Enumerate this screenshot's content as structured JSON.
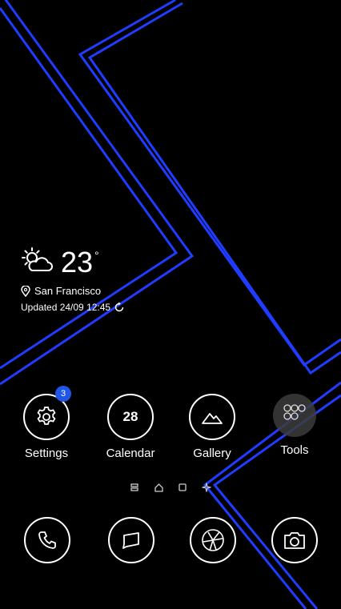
{
  "weather": {
    "temperature": "23",
    "unit": "°",
    "location": "San Francisco",
    "updated": "Updated 24/09 12:45",
    "icon": "partly-cloudy-icon"
  },
  "apps": [
    {
      "label": "Settings",
      "badge": "3",
      "icon": "gear-icon"
    },
    {
      "label": "Calendar",
      "day": "28",
      "icon": "calendar-icon"
    },
    {
      "label": "Gallery",
      "icon": "mountain-icon"
    },
    {
      "label": "Tools",
      "icon": "folder-icon"
    }
  ],
  "dock": [
    {
      "icon": "phone-icon"
    },
    {
      "icon": "message-icon"
    },
    {
      "icon": "browser-icon"
    },
    {
      "icon": "camera-icon"
    }
  ],
  "colors": {
    "accent": "#1f56e6",
    "wallpaper_line": "#1f3cff",
    "background": "#000000"
  }
}
